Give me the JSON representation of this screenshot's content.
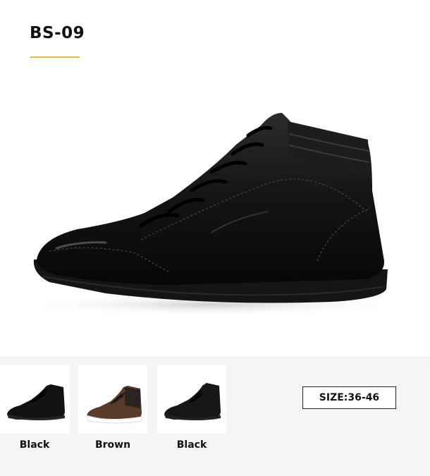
{
  "header": {
    "title": "BS-09",
    "accent_color": "#e2b93b"
  },
  "hero": {
    "image": "black-high-top-leather-boot"
  },
  "variants": [
    {
      "label": "Black",
      "image": "black-leather-boot-thumbnail",
      "color": "#111111"
    },
    {
      "label": "Brown",
      "image": "brown-suede-boot-thumbnail",
      "color": "#5a3a28"
    },
    {
      "label": "Black",
      "image": "black-suede-boot-thumbnail",
      "color": "#151515"
    }
  ],
  "size": {
    "label": "SIZE:36-46"
  }
}
